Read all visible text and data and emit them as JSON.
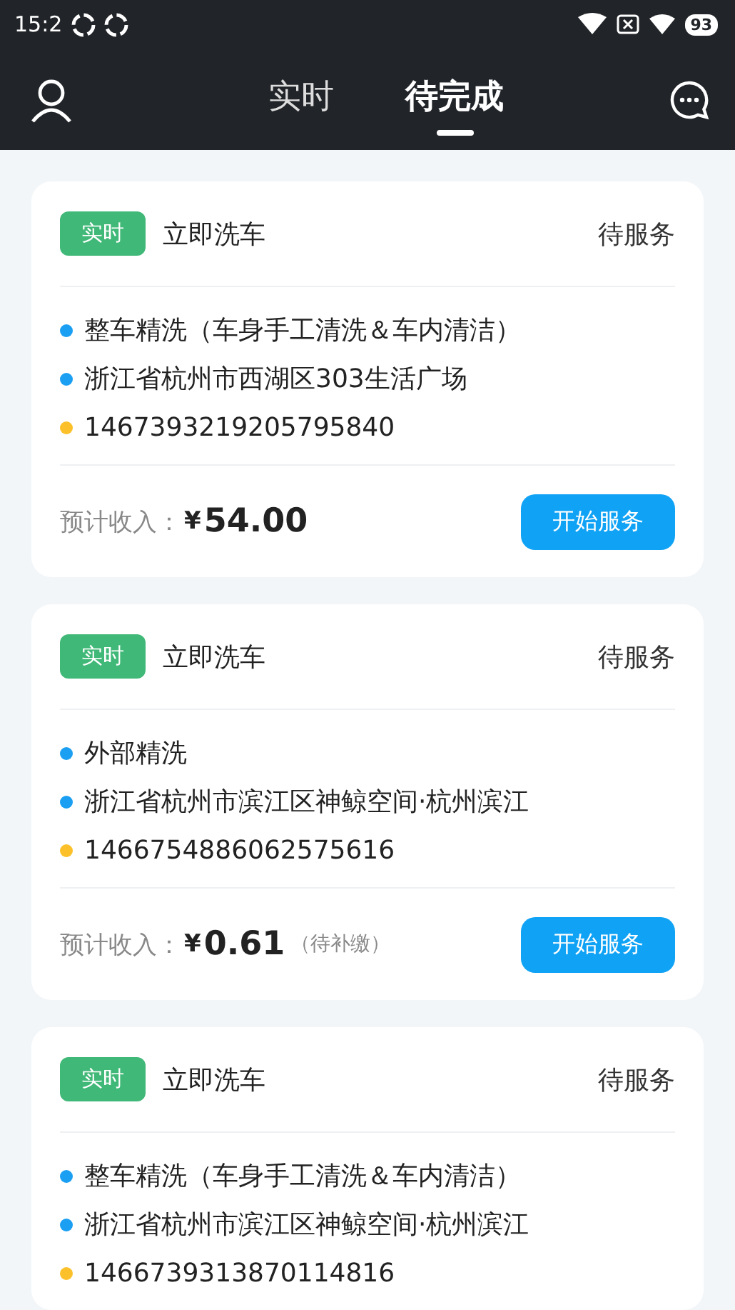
{
  "status_bar": {
    "time": "15:2",
    "battery": "93"
  },
  "header": {
    "tabs": [
      {
        "label": "实时",
        "selected": false
      },
      {
        "label": "待完成",
        "selected": true
      }
    ]
  },
  "orders": [
    {
      "tag": "实时",
      "type": "立即洗车",
      "status": "待服务",
      "lines": [
        {
          "text": "整车精洗（车身手工清洗＆车内清洁）",
          "color": "#1a9ff2"
        },
        {
          "text": "浙江省杭州市西湖区303生活广场",
          "color": "#1a9ff2"
        },
        {
          "text": "1467393219205795840",
          "color": "#fcc12a"
        }
      ],
      "income_label": "预计收入：",
      "currency": "¥",
      "amount": "54.00",
      "button": "开始服务"
    },
    {
      "tag": "实时",
      "type": "立即洗车",
      "status": "待服务",
      "lines": [
        {
          "text": "外部精洗",
          "color": "#1a9ff2"
        },
        {
          "text": "浙江省杭州市滨江区神鲸空间·杭州滨江",
          "color": "#1a9ff2"
        },
        {
          "text": "1466754886062575616",
          "color": "#fcc12a"
        }
      ],
      "income_label": "预计收入：",
      "currency": "¥",
      "amount": "0.61",
      "note": "（待补缴）",
      "button": "开始服务"
    },
    {
      "tag": "实时",
      "type": "立即洗车",
      "status": "待服务",
      "lines": [
        {
          "text": "整车精洗（车身手工清洗＆车内清洁）",
          "color": "#1a9ff2"
        },
        {
          "text": "浙江省杭州市滨江区神鲸空间·杭州滨江",
          "color": "#1a9ff2"
        },
        {
          "text": "1466739313870114816",
          "color": "#fcc12a"
        }
      ]
    }
  ]
}
